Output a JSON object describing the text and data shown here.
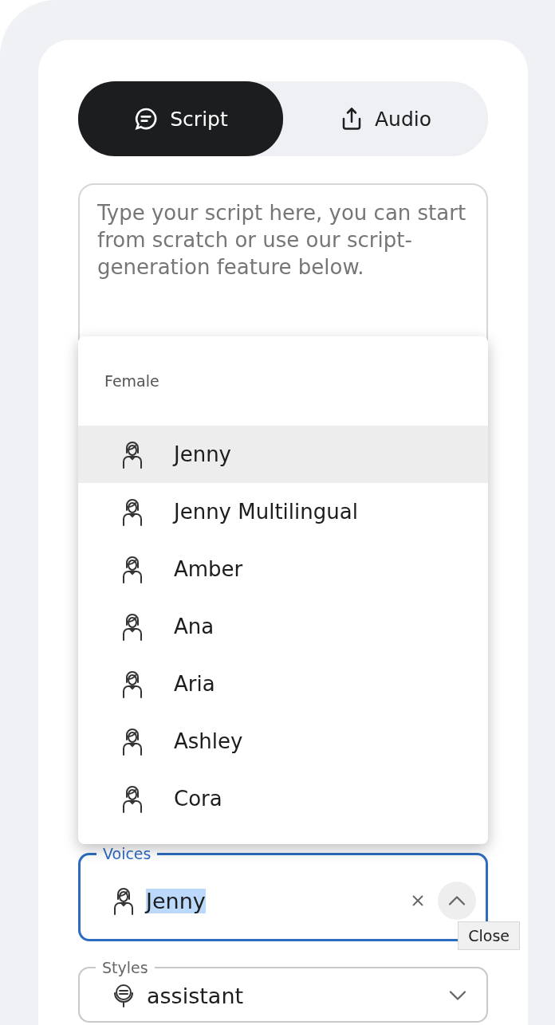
{
  "tabs": [
    {
      "label": "Script",
      "kind": "chat",
      "selected": true
    },
    {
      "label": "Audio",
      "kind": "upload",
      "selected": false
    }
  ],
  "script_field": {
    "placeholder": "Type your script here, you can start from scratch or use our script-generation feature below."
  },
  "voice_menu": {
    "group_label": "Female",
    "items": [
      {
        "label": "Jenny",
        "highlighted": true
      },
      {
        "label": "Jenny Multilingual",
        "highlighted": false
      },
      {
        "label": "Amber",
        "highlighted": false
      },
      {
        "label": "Ana",
        "highlighted": false
      },
      {
        "label": "Aria",
        "highlighted": false
      },
      {
        "label": "Ashley",
        "highlighted": false
      },
      {
        "label": "Cora",
        "highlighted": false
      }
    ]
  },
  "voices_field": {
    "label": "Voices",
    "value": "Jenny",
    "value_selected": true,
    "focused": true,
    "expanded": true
  },
  "tooltip": "Close",
  "styles_field": {
    "label": "Styles",
    "value": "assistant",
    "expanded": false
  }
}
